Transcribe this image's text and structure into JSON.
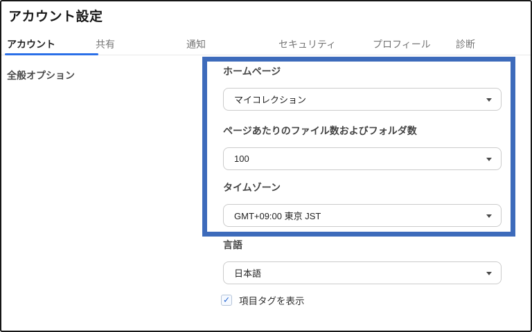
{
  "window": {
    "title": "アカウント設定"
  },
  "tabs": [
    {
      "label": "アカウント",
      "active": true
    },
    {
      "label": "共有",
      "active": false
    },
    {
      "label": "通知",
      "active": false
    },
    {
      "label": "セキュリティ",
      "active": false
    },
    {
      "label": "プロフィール",
      "active": false
    },
    {
      "label": "診断",
      "active": false
    }
  ],
  "sidebar": {
    "section_label": "全般オプション"
  },
  "form": {
    "fields": [
      {
        "label": "ホームページ",
        "value": "マイコレクション"
      },
      {
        "label": "ページあたりのファイル数およびフォルダ数",
        "value": "100"
      },
      {
        "label": "タイムゾーン",
        "value": "GMT+09:00 東京 JST"
      },
      {
        "label": "言語",
        "value": "日本語"
      }
    ],
    "checkbox": {
      "label": "項目タグを表示",
      "checked": true
    }
  },
  "icons": {
    "caret_down_icon": "css-triangle-down",
    "check_icon": "✓"
  },
  "colors": {
    "tab_accent": "#2a6fe8",
    "highlight_box": "#3d6bbb",
    "checkbox_check": "#2163d1"
  },
  "annotation": {
    "type": "highlight-rectangle",
    "color": "#3d6bbb"
  }
}
